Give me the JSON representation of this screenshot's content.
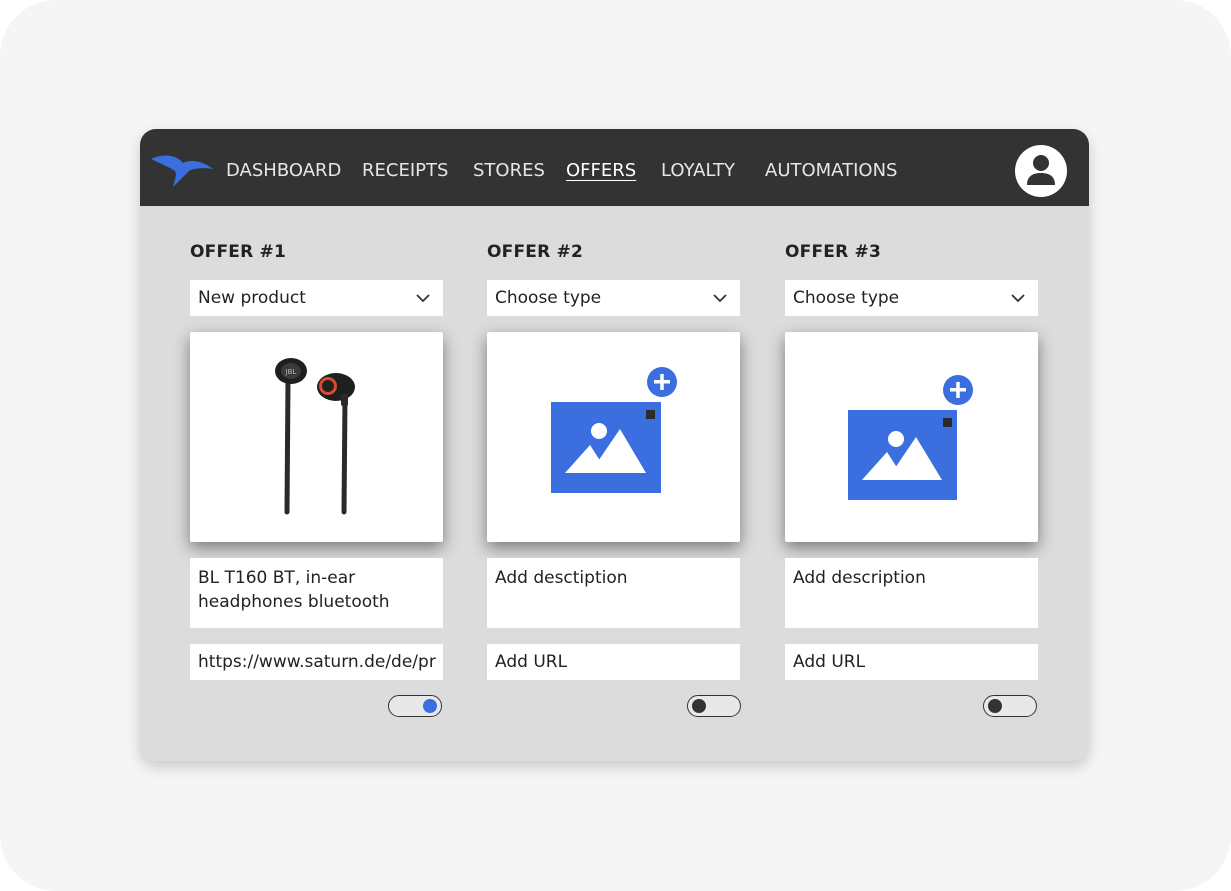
{
  "nav": {
    "items": [
      {
        "label": "DASHBOARD",
        "active": false
      },
      {
        "label": "RECEIPTS",
        "active": false
      },
      {
        "label": "STORES",
        "active": false
      },
      {
        "label": "OFFERS",
        "active": true
      },
      {
        "label": "LOYALTY",
        "active": false
      },
      {
        "label": "AUTOMATIONS",
        "active": false
      }
    ],
    "logo_icon": "bird-logo-icon",
    "avatar_icon": "user-avatar-icon"
  },
  "offers": [
    {
      "title": "OFFER #1",
      "type": "New product",
      "image": "earphones-product-image",
      "description": "BL T160 BT, in-ear headphones bluetooth",
      "url": "https://www.saturn.de/de/pr",
      "enabled": true
    },
    {
      "title": "OFFER #2",
      "type": "Choose type",
      "image": "add-image-icon",
      "description": "Add desctiption",
      "url": "Add URL",
      "enabled": false
    },
    {
      "title": "OFFER #3",
      "type": "Choose type",
      "image": "add-image-icon",
      "description": "Add description",
      "url": "Add URL",
      "enabled": false
    }
  ],
  "colors": {
    "topbar": "#333333",
    "accent": "#3b6fe0",
    "panel": "#dcdcdc"
  }
}
